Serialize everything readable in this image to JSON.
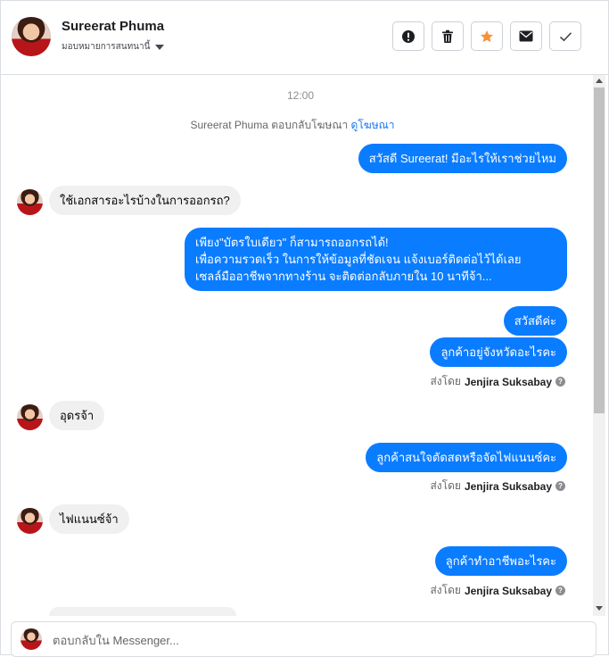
{
  "header": {
    "contact_name": "Sureerat Phuma",
    "assign_label": "มอบหมายการสนทนานี้",
    "actions": [
      {
        "icon": "alert-icon",
        "name": "mark-spam-button"
      },
      {
        "icon": "trash-icon",
        "name": "delete-button"
      },
      {
        "icon": "star-icon",
        "name": "star-button",
        "color": "#f7923b"
      },
      {
        "icon": "mail-icon",
        "name": "mark-unread-button"
      },
      {
        "icon": "check-icon",
        "name": "mark-done-button"
      }
    ]
  },
  "conversation": {
    "time": "12:00",
    "reply_note": {
      "text": "Sureerat Phuma ตอบกลับโฆษณา",
      "link": "ดูโฆษณา"
    },
    "messages": [
      {
        "dir": "out",
        "text": "สวัสดี Sureerat! มีอะไรให้เราช่วยไหม"
      },
      {
        "dir": "in",
        "text": "ใช้เอกสารอะไรบ้างในการออกรถ?"
      },
      {
        "dir": "out",
        "lines": [
          "เพียง\"บัตรใบเดียว\" ก็สามารถออกรถได้!",
          "เพื่อความรวดเร็ว ในการให้ข้อมูลที่ชัดเจน แจ้งเบอร์ติดต่อไว้ได้เลย",
          "เซลล์มืออาชีพจากทางร้าน จะติดต่อกลับภายใน 10 นาทีจ้า..."
        ]
      },
      {
        "dir": "out",
        "text": "สวัสดีค่ะ"
      },
      {
        "dir": "out",
        "text": "ลูกค้าอยู่จังหวัดอะไรคะ"
      },
      {
        "dir": "in",
        "text": "อุดรจ้า"
      },
      {
        "dir": "out",
        "text": "ลูกค้าสนใจตัดสดหรือจัดไฟแนนซ์คะ"
      },
      {
        "dir": "in",
        "text": "ไฟแนนซ์จ้า"
      },
      {
        "dir": "out",
        "text": "ลูกค้าทำอาชีพอะไรคะ"
      }
    ],
    "sent_by_prefix": "ส่งโดย",
    "sent_by_name": "Jenjira Suksabay",
    "help_glyph": "?"
  },
  "composer": {
    "placeholder": "ตอบกลับใน Messenger..."
  },
  "colors": {
    "outgoing_bubble": "#0a7cff",
    "incoming_bubble": "#f0f0f0",
    "link": "#1877f2"
  }
}
